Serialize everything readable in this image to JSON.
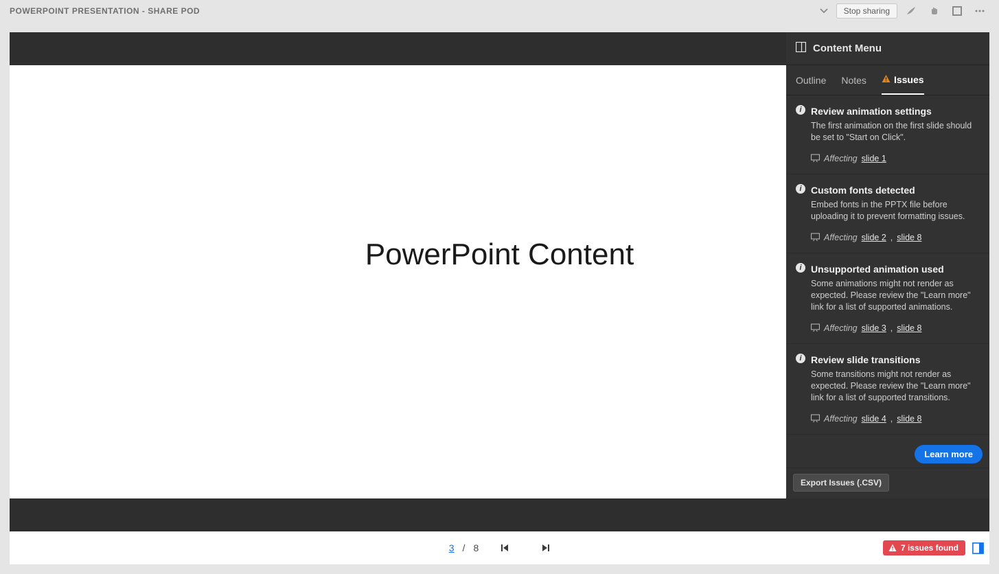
{
  "header": {
    "title": "POWERPOINT PRESENTATION - SHARE POD",
    "stop_sharing": "Stop sharing"
  },
  "slide": {
    "content": "PowerPoint Content"
  },
  "panel": {
    "title": "Content Menu",
    "tabs": {
      "outline": "Outline",
      "notes": "Notes",
      "issues": "Issues"
    },
    "learn_more": "Learn more",
    "export_label": "Export Issues (.CSV)",
    "affecting_label": "Affecting"
  },
  "issues": [
    {
      "title": "Review animation settings",
      "desc": "The first animation on the first slide should be set to \"Start on Click\".",
      "slides": [
        "slide 1"
      ]
    },
    {
      "title": "Custom fonts detected",
      "desc": "Embed fonts in the PPTX file before uploading it to prevent formatting issues.",
      "slides": [
        "slide 2",
        "slide 8"
      ]
    },
    {
      "title": "Unsupported animation used",
      "desc": "Some animations might not render as expected. Please review the \"Learn more\" link for a list of supported animations.",
      "slides": [
        "slide 3",
        "slide 8"
      ]
    },
    {
      "title": "Review slide transitions",
      "desc": "Some transitions might not render as expected. Please review the \"Learn more\" link for a list of supported transitions.",
      "slides": [
        "slide 4",
        "slide 8"
      ]
    }
  ],
  "pagination": {
    "current": "3",
    "sep": "/",
    "total": "8"
  },
  "footer": {
    "issues_badge": "7 issues found"
  }
}
